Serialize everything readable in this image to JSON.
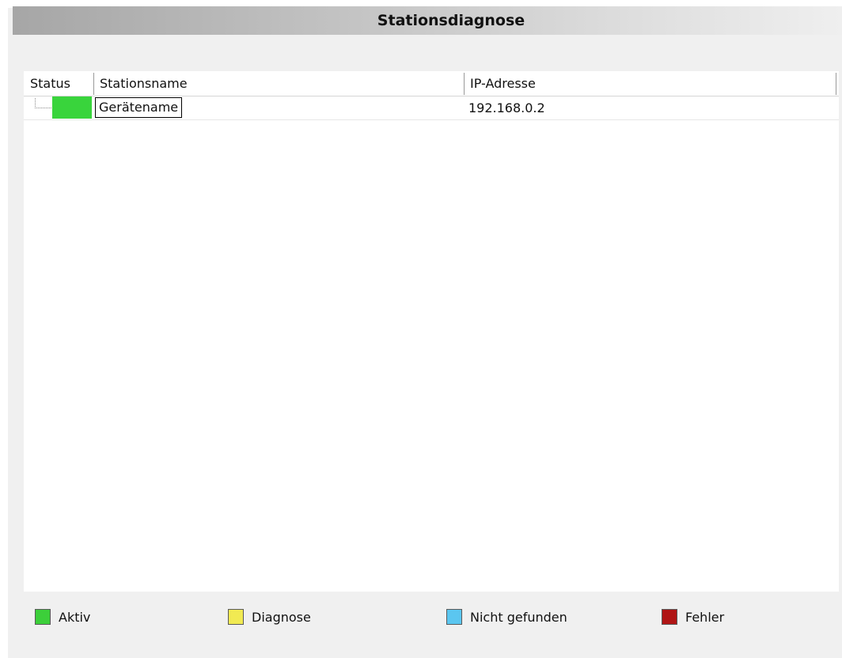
{
  "title": "Stationsdiagnose",
  "table": {
    "columns": [
      {
        "label": "Status"
      },
      {
        "label": "Stationsname"
      },
      {
        "label": "IP-Adresse"
      }
    ],
    "rows": [
      {
        "status": "Aktiv",
        "status_color": "#39d43c",
        "name": "Gerätename",
        "ip": "192.168.0.2"
      }
    ]
  },
  "legend": [
    {
      "label": "Aktiv",
      "color": "#3ccf3a"
    },
    {
      "label": "Diagnose",
      "color": "#f1ea52"
    },
    {
      "label": "Nicht gefunden",
      "color": "#5bc6f0"
    },
    {
      "label": "Fehler",
      "color": "#b01515"
    }
  ]
}
